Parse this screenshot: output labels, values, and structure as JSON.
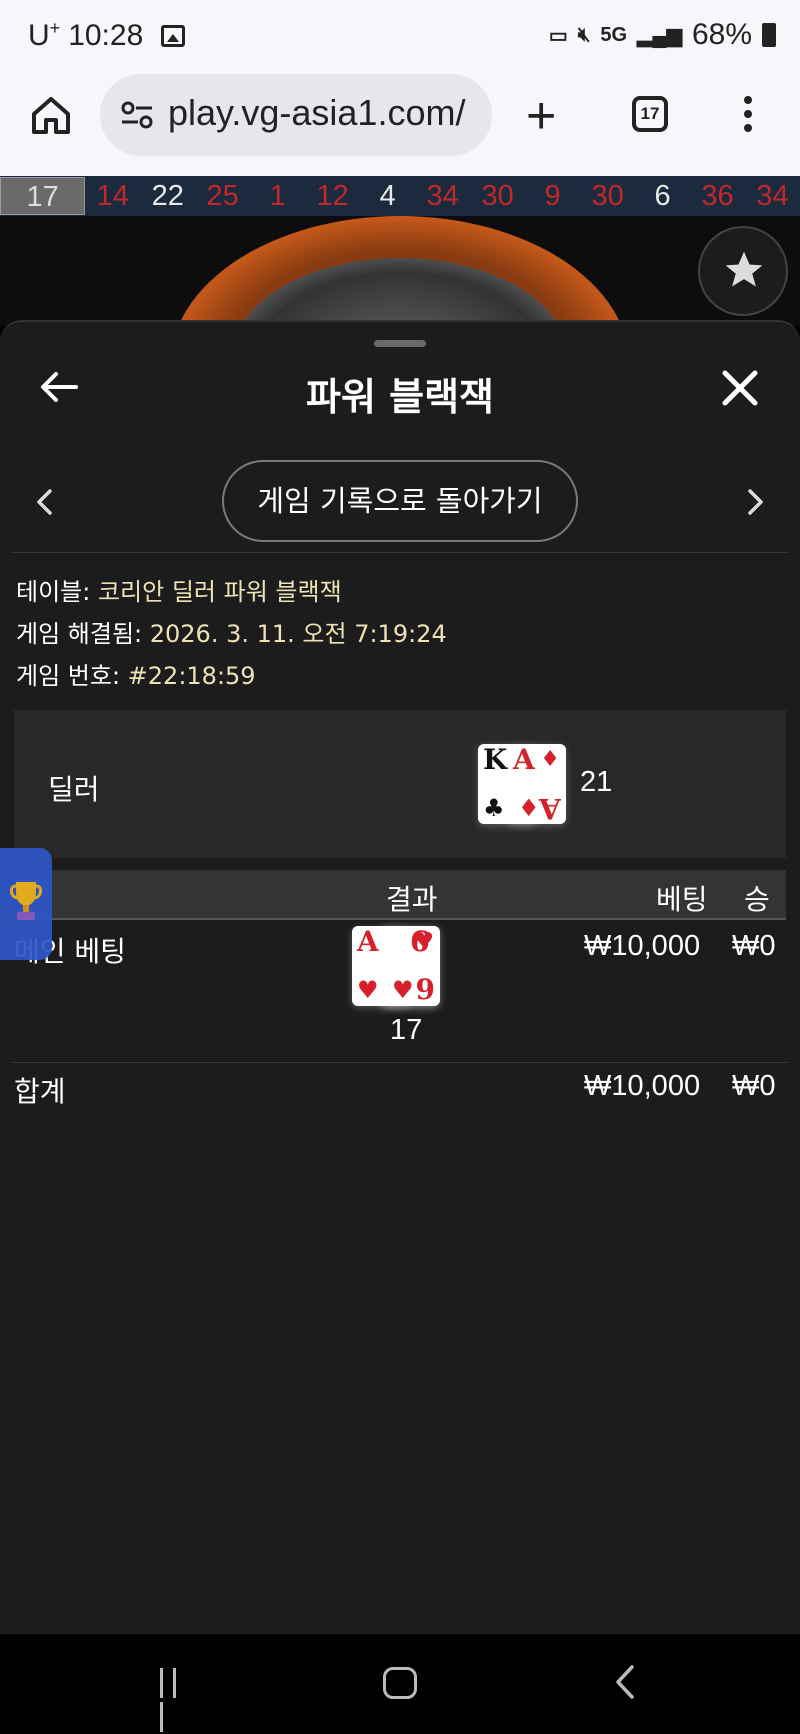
{
  "status_bar": {
    "carrier": "U",
    "carrier_sup": "+",
    "time": "10:28",
    "network": "5G",
    "battery": "68%"
  },
  "browser": {
    "url": "play.vg-asia1.com/",
    "tab_count": "17"
  },
  "roulette_strip": {
    "latest": "17",
    "numbers": [
      {
        "n": "14",
        "c": "red"
      },
      {
        "n": "22",
        "c": "black"
      },
      {
        "n": "25",
        "c": "red"
      },
      {
        "n": "1",
        "c": "red"
      },
      {
        "n": "12",
        "c": "red"
      },
      {
        "n": "4",
        "c": "black"
      },
      {
        "n": "34",
        "c": "red"
      },
      {
        "n": "30",
        "c": "red"
      },
      {
        "n": "9",
        "c": "red"
      },
      {
        "n": "30",
        "c": "red"
      },
      {
        "n": "6",
        "c": "black"
      },
      {
        "n": "36",
        "c": "red"
      },
      {
        "n": "34",
        "c": "red"
      }
    ]
  },
  "sheet": {
    "title": "파워 블랙잭",
    "history_button": "게임 기록으로 돌아가기",
    "info": {
      "table_label": "테이블: ",
      "table_value": "코리안 딜러 파워 블랙잭",
      "resolved_label": "게임 해결됨: ",
      "resolved_value": "2026. 3. 11. 오전 7:19:24",
      "game_no_label": "게임 번호: ",
      "game_no_value": "#22:18:59"
    },
    "dealer": {
      "label": "딜러",
      "cards": [
        {
          "rank": "K",
          "suit": "♣",
          "color": "black"
        },
        {
          "rank": "A",
          "suit": "♦",
          "color": "red"
        }
      ],
      "total": "21"
    },
    "results_header": {
      "result": "결과",
      "bet": "베팅",
      "win": "승"
    },
    "main_bet": {
      "label": "메인 베팅",
      "cards": [
        {
          "rank": "A",
          "suit": "♥",
          "color": "red"
        },
        {
          "rank": "6",
          "suit": "♥",
          "color": "red"
        },
        {
          "rank": "9",
          "suit": "♥",
          "color": "red"
        }
      ],
      "total": "17",
      "bet": "₩10,000",
      "win": "₩0"
    },
    "total_row": {
      "label": "합계",
      "bet": "₩10,000",
      "win": "₩0"
    }
  },
  "colors": {
    "red_number": "#c0282c",
    "sheet_bg": "#1c1c1c",
    "info_value": "#ede2b3",
    "trophy_tab": "#2f56c8"
  }
}
